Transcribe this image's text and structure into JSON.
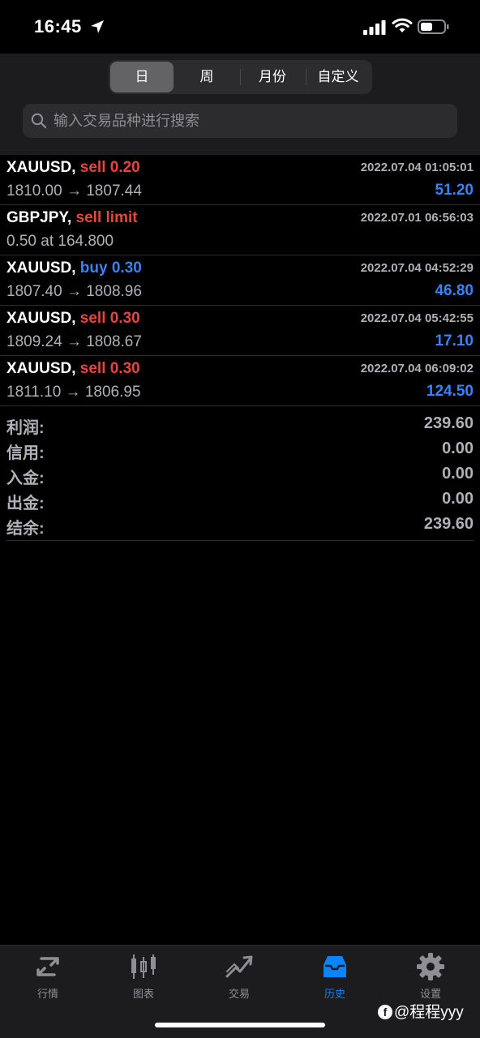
{
  "status_bar": {
    "time": "16:45"
  },
  "header": {
    "segments": [
      {
        "label": "日",
        "active": true
      },
      {
        "label": "周",
        "active": false
      },
      {
        "label": "月份",
        "active": false
      },
      {
        "label": "自定义",
        "active": false
      }
    ],
    "search": {
      "placeholder": "输入交易品种进行搜索",
      "value": ""
    }
  },
  "orders": [
    {
      "symbol": "XAUUSD,",
      "side": "sell 0.20",
      "time": "2022.07.04 01:05:01",
      "prices": "1810.00 → 1807.44",
      "profit": "51.20"
    },
    {
      "symbol": "GBPJPY,",
      "side": "sell limit",
      "time": "2022.07.01 06:56:03",
      "prices": "0.50 at 164.800",
      "profit": ""
    },
    {
      "symbol": "XAUUSD,",
      "side": "buy 0.30",
      "time": "2022.07.04 04:52:29",
      "prices": "1807.40 → 1808.96",
      "profit": "46.80"
    },
    {
      "symbol": "XAUUSD,",
      "side": "sell 0.30",
      "time": "2022.07.04 05:42:55",
      "prices": "1809.24 → 1808.67",
      "profit": "17.10"
    },
    {
      "symbol": "XAUUSD,",
      "side": "sell 0.30",
      "time": "2022.07.04 06:09:02",
      "prices": "1811.10 → 1806.95",
      "profit": "124.50"
    }
  ],
  "summary": [
    {
      "label": "利润:",
      "value": "239.60"
    },
    {
      "label": "信用:",
      "value": "0.00"
    },
    {
      "label": "入金:",
      "value": "0.00"
    },
    {
      "label": "出金:",
      "value": "0.00"
    },
    {
      "label": "结余:",
      "value": "239.60"
    }
  ],
  "tabs": [
    {
      "label": "行情",
      "icon": "quotes-icon",
      "active": false
    },
    {
      "label": "图表",
      "icon": "chart-icon",
      "active": false
    },
    {
      "label": "交易",
      "icon": "trade-icon",
      "active": false
    },
    {
      "label": "历史",
      "icon": "history-icon",
      "active": true
    },
    {
      "label": "设置",
      "icon": "settings-icon",
      "active": false
    }
  ],
  "watermark": "@程程yyy",
  "colors": {
    "sell": "#e5473f",
    "buy": "#3a82f7",
    "active_tab": "#0a84ff",
    "background": "#000000",
    "panel": "#1c1c1e"
  }
}
